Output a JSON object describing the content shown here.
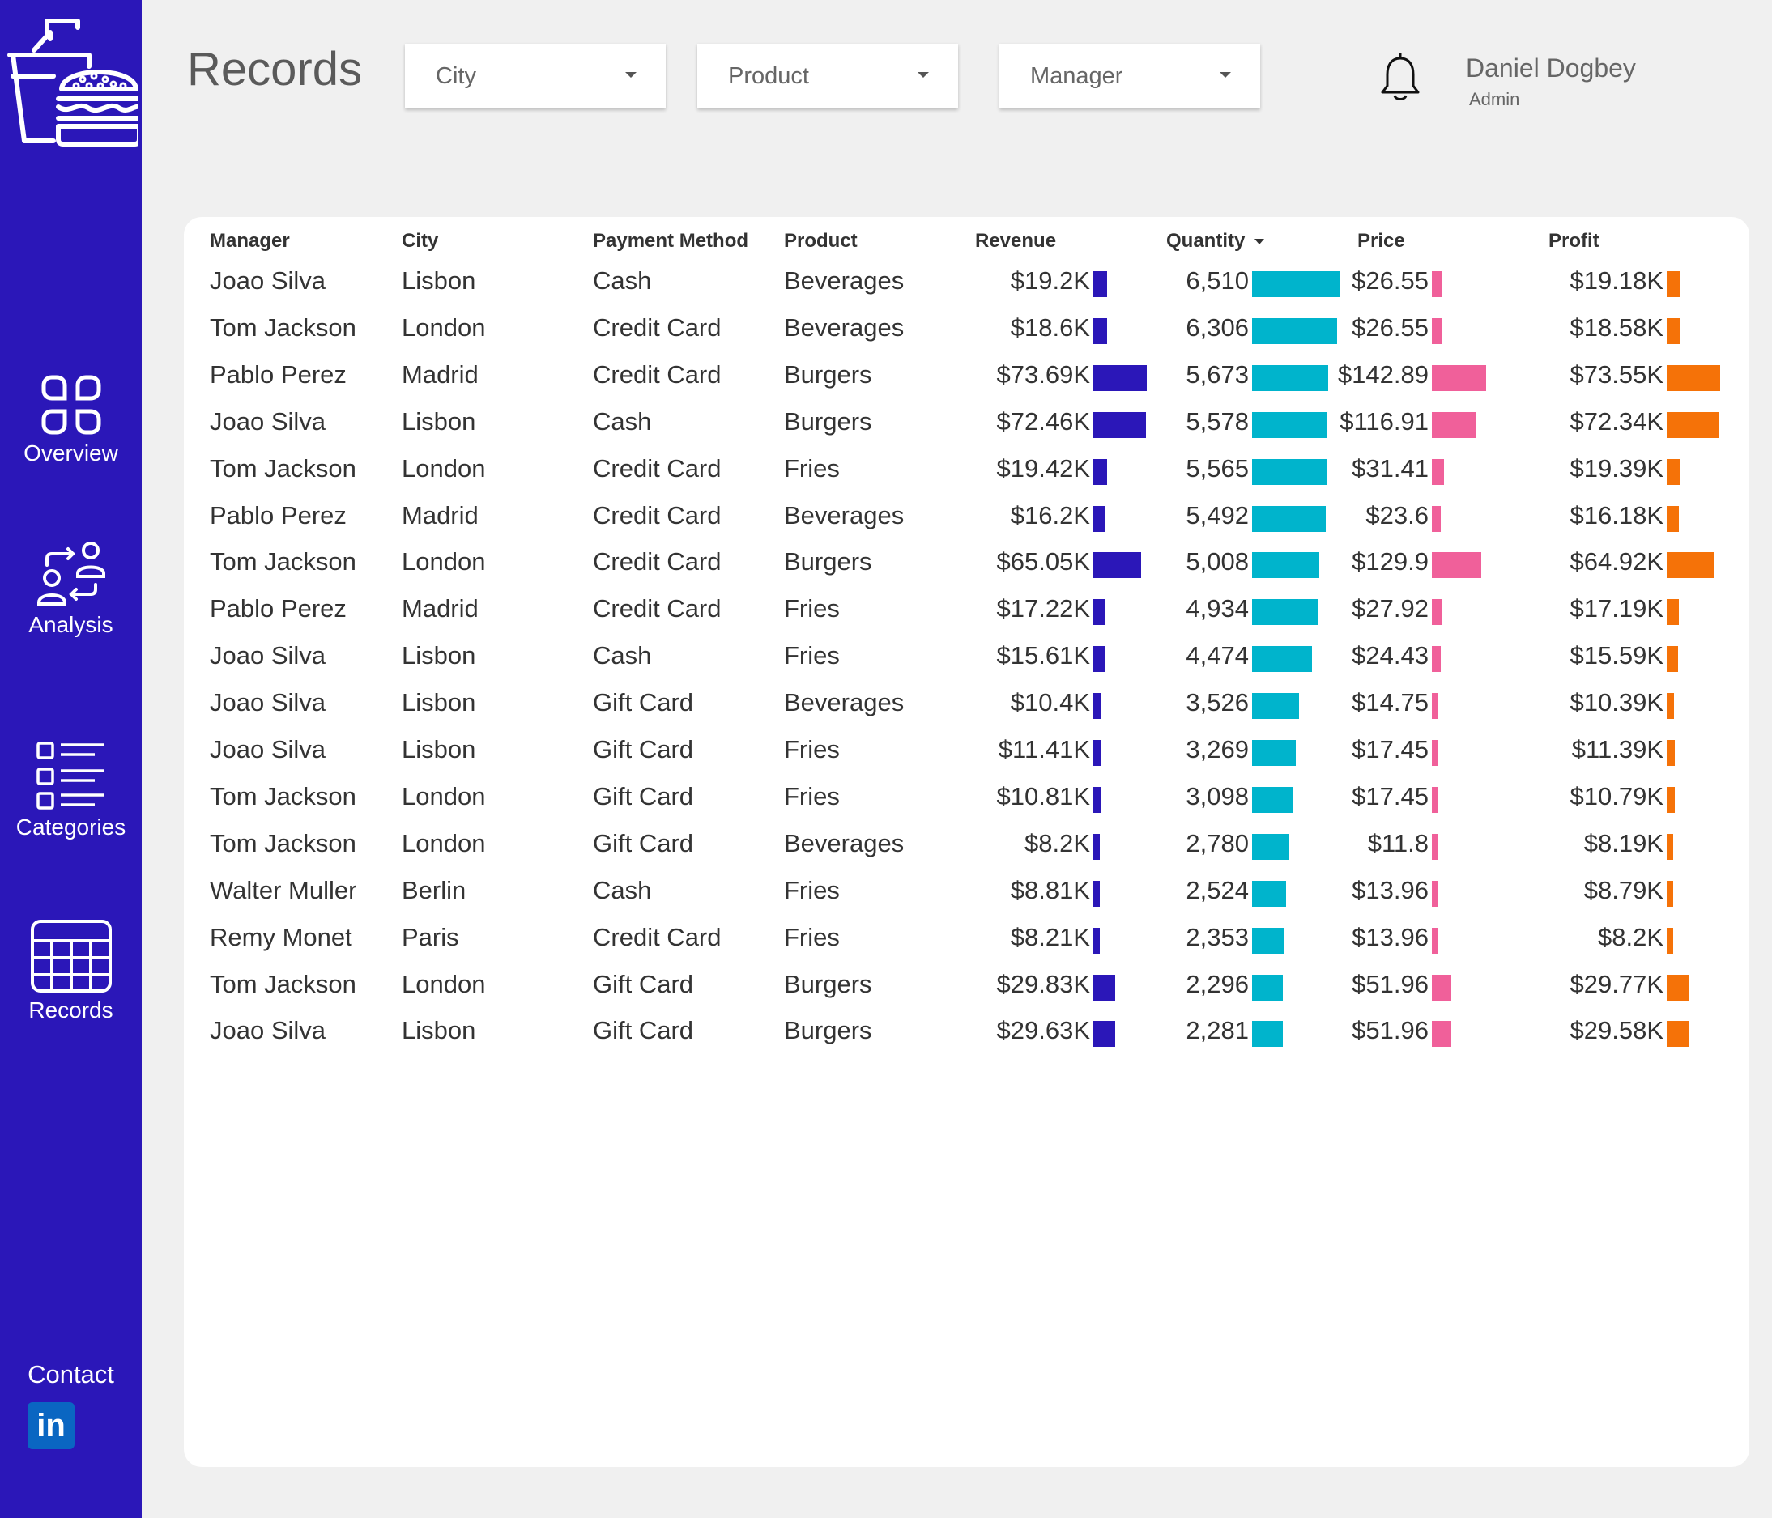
{
  "sidebar": {
    "nav": [
      {
        "label": "Overview",
        "icon": "overview-icon"
      },
      {
        "label": "Analysis",
        "icon": "analysis-icon"
      },
      {
        "label": "Categories",
        "icon": "categories-icon"
      },
      {
        "label": "Records",
        "icon": "records-icon"
      }
    ],
    "contact_label": "Contact",
    "linkedin_text": "in"
  },
  "header": {
    "title": "Records",
    "filters": [
      {
        "label": "City"
      },
      {
        "label": "Product"
      },
      {
        "label": "Manager"
      }
    ],
    "user": {
      "name": "Daniel Dogbey",
      "role": "Admin"
    }
  },
  "table": {
    "columns": [
      "Manager",
      "City",
      "Payment Method",
      "Product",
      "Revenue",
      "Quantity",
      "Price",
      "Profit"
    ],
    "sorted_by": "Quantity",
    "rows": [
      {
        "manager": "Joao Silva",
        "city": "Lisbon",
        "payment": "Cash",
        "product": "Beverages",
        "revenue": "$19.2K",
        "quantity": "6,510",
        "price": "$26.55",
        "profit": "$19.18K",
        "revenue_value": 19.2,
        "quantity_value": 6510,
        "price_value": 26.55,
        "profit_value": 19.18
      },
      {
        "manager": "Tom Jackson",
        "city": "London",
        "payment": "Credit Card",
        "product": "Beverages",
        "revenue": "$18.6K",
        "quantity": "6,306",
        "price": "$26.55",
        "profit": "$18.58K",
        "revenue_value": 18.6,
        "quantity_value": 6306,
        "price_value": 26.55,
        "profit_value": 18.58
      },
      {
        "manager": "Pablo Perez",
        "city": "Madrid",
        "payment": "Credit Card",
        "product": "Burgers",
        "revenue": "$73.69K",
        "quantity": "5,673",
        "price": "$142.89",
        "profit": "$73.55K",
        "revenue_value": 73.69,
        "quantity_value": 5673,
        "price_value": 142.89,
        "profit_value": 73.55
      },
      {
        "manager": "Joao Silva",
        "city": "Lisbon",
        "payment": "Cash",
        "product": "Burgers",
        "revenue": "$72.46K",
        "quantity": "5,578",
        "price": "$116.91",
        "profit": "$72.34K",
        "revenue_value": 72.46,
        "quantity_value": 5578,
        "price_value": 116.91,
        "profit_value": 72.34
      },
      {
        "manager": "Tom Jackson",
        "city": "London",
        "payment": "Credit Card",
        "product": "Fries",
        "revenue": "$19.42K",
        "quantity": "5,565",
        "price": "$31.41",
        "profit": "$19.39K",
        "revenue_value": 19.42,
        "quantity_value": 5565,
        "price_value": 31.41,
        "profit_value": 19.39
      },
      {
        "manager": "Pablo Perez",
        "city": "Madrid",
        "payment": "Credit Card",
        "product": "Beverages",
        "revenue": "$16.2K",
        "quantity": "5,492",
        "price": "$23.6",
        "profit": "$16.18K",
        "revenue_value": 16.2,
        "quantity_value": 5492,
        "price_value": 23.6,
        "profit_value": 16.18
      },
      {
        "manager": "Tom Jackson",
        "city": "London",
        "payment": "Credit Card",
        "product": "Burgers",
        "revenue": "$65.05K",
        "quantity": "5,008",
        "price": "$129.9",
        "profit": "$64.92K",
        "revenue_value": 65.05,
        "quantity_value": 5008,
        "price_value": 129.9,
        "profit_value": 64.92
      },
      {
        "manager": "Pablo Perez",
        "city": "Madrid",
        "payment": "Credit Card",
        "product": "Fries",
        "revenue": "$17.22K",
        "quantity": "4,934",
        "price": "$27.92",
        "profit": "$17.19K",
        "revenue_value": 17.22,
        "quantity_value": 4934,
        "price_value": 27.92,
        "profit_value": 17.19
      },
      {
        "manager": "Joao Silva",
        "city": "Lisbon",
        "payment": "Cash",
        "product": "Fries",
        "revenue": "$15.61K",
        "quantity": "4,474",
        "price": "$24.43",
        "profit": "$15.59K",
        "revenue_value": 15.61,
        "quantity_value": 4474,
        "price_value": 24.43,
        "profit_value": 15.59
      },
      {
        "manager": "Joao Silva",
        "city": "Lisbon",
        "payment": "Gift Card",
        "product": "Beverages",
        "revenue": "$10.4K",
        "quantity": "3,526",
        "price": "$14.75",
        "profit": "$10.39K",
        "revenue_value": 10.4,
        "quantity_value": 3526,
        "price_value": 14.75,
        "profit_value": 10.39
      },
      {
        "manager": "Joao Silva",
        "city": "Lisbon",
        "payment": "Gift Card",
        "product": "Fries",
        "revenue": "$11.41K",
        "quantity": "3,269",
        "price": "$17.45",
        "profit": "$11.39K",
        "revenue_value": 11.41,
        "quantity_value": 3269,
        "price_value": 17.45,
        "profit_value": 11.39
      },
      {
        "manager": "Tom Jackson",
        "city": "London",
        "payment": "Gift Card",
        "product": "Fries",
        "revenue": "$10.81K",
        "quantity": "3,098",
        "price": "$17.45",
        "profit": "$10.79K",
        "revenue_value": 10.81,
        "quantity_value": 3098,
        "price_value": 17.45,
        "profit_value": 10.79
      },
      {
        "manager": "Tom Jackson",
        "city": "London",
        "payment": "Gift Card",
        "product": "Beverages",
        "revenue": "$8.2K",
        "quantity": "2,780",
        "price": "$11.8",
        "profit": "$8.19K",
        "revenue_value": 8.2,
        "quantity_value": 2780,
        "price_value": 11.8,
        "profit_value": 8.19
      },
      {
        "manager": "Walter Muller",
        "city": "Berlin",
        "payment": "Cash",
        "product": "Fries",
        "revenue": "$8.81K",
        "quantity": "2,524",
        "price": "$13.96",
        "profit": "$8.79K",
        "revenue_value": 8.81,
        "quantity_value": 2524,
        "price_value": 13.96,
        "profit_value": 8.79
      },
      {
        "manager": "Remy Monet",
        "city": "Paris",
        "payment": "Credit Card",
        "product": "Fries",
        "revenue": "$8.21K",
        "quantity": "2,353",
        "price": "$13.96",
        "profit": "$8.2K",
        "revenue_value": 8.21,
        "quantity_value": 2353,
        "price_value": 13.96,
        "profit_value": 8.2
      },
      {
        "manager": "Tom Jackson",
        "city": "London",
        "payment": "Gift Card",
        "product": "Burgers",
        "revenue": "$29.83K",
        "quantity": "2,296",
        "price": "$51.96",
        "profit": "$29.77K",
        "revenue_value": 29.83,
        "quantity_value": 2296,
        "price_value": 51.96,
        "profit_value": 29.77
      },
      {
        "manager": "Joao Silva",
        "city": "Lisbon",
        "payment": "Gift Card",
        "product": "Burgers",
        "revenue": "$29.63K",
        "quantity": "2,281",
        "price": "$51.96",
        "profit": "$29.58K",
        "revenue_value": 29.63,
        "quantity_value": 2281,
        "price_value": 51.96,
        "profit_value": 29.58
      }
    ]
  },
  "colors": {
    "sidebar": "#2b17b8",
    "revenue_bar": "#2b17b8",
    "quantity_bar": "#00b4cc",
    "price_bar": "#f0609a",
    "profit_bar": "#f57208"
  }
}
